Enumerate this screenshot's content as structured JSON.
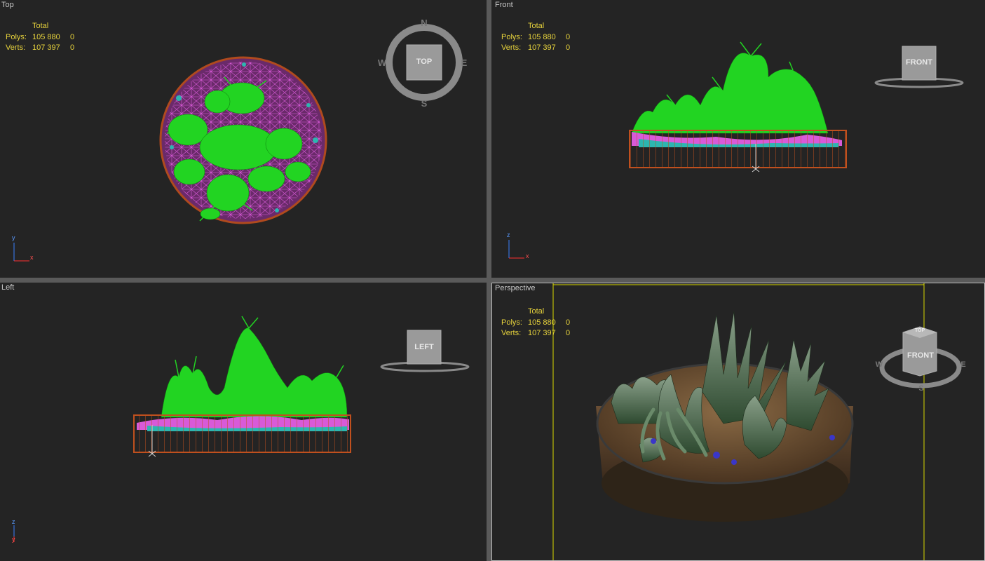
{
  "viewports": [
    {
      "id": "top",
      "label": "Top",
      "cube_label": "TOP",
      "compass": {
        "n": "N",
        "s": "S",
        "w": "W",
        "e": "E"
      },
      "axes": {
        "v": "y",
        "h": "x"
      }
    },
    {
      "id": "front",
      "label": "Front",
      "cube_label": "FRONT",
      "axes": {
        "v": "z",
        "h": "x"
      }
    },
    {
      "id": "left",
      "label": "Left",
      "cube_label": "LEFT",
      "axes": {
        "v": "z",
        "h": "y"
      }
    },
    {
      "id": "perspective",
      "label": "Perspective",
      "cube_label": "FRONT",
      "cube_top_label": "TOP",
      "compass": {
        "w": "W",
        "e": "E",
        "s": "S"
      }
    }
  ],
  "stats": {
    "header": "Total",
    "polys_label": "Polys:",
    "polys_total": "105 880",
    "polys_selected": "0",
    "verts_label": "Verts:",
    "verts_total": "107 397",
    "verts_selected": "0"
  },
  "colors": {
    "viewport_bg": "#242424",
    "stats_text": "#e6d23c",
    "wire_plant": "#22d422",
    "wire_pot": "#c0501e",
    "wire_soil": "#d85ad8",
    "wire_stone": "#2cb6b0",
    "safe_frame": "#d8d800",
    "active_border": "#bdbdbd"
  }
}
